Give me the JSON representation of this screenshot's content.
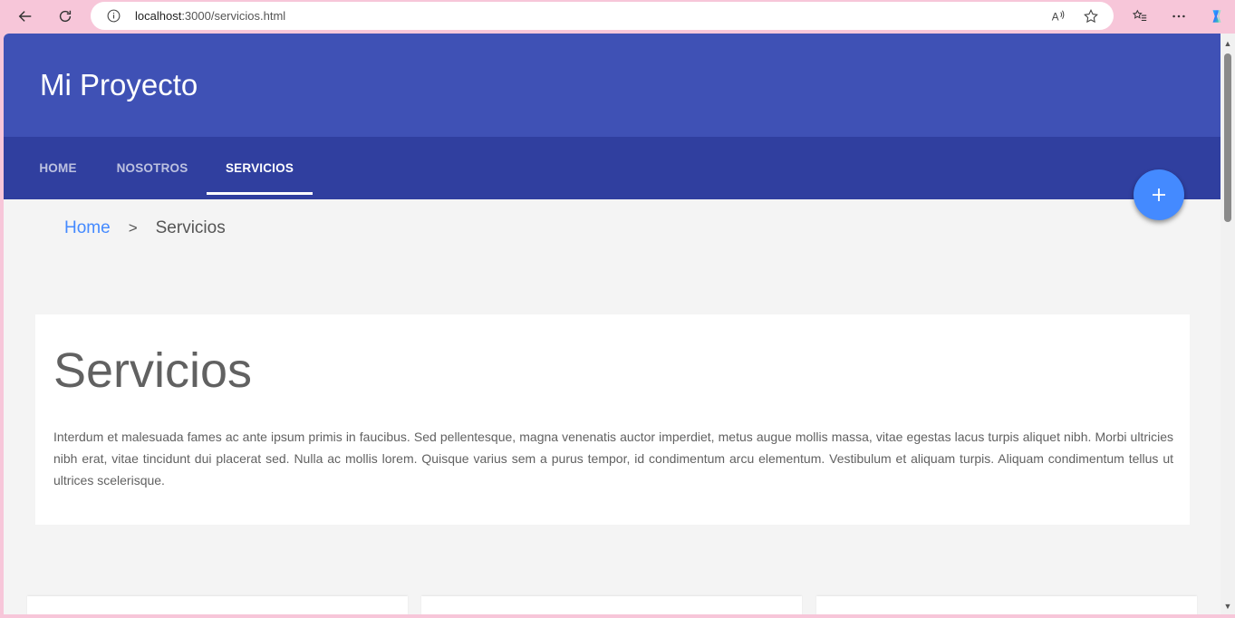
{
  "browser": {
    "url_host": "localhost",
    "url_rest": ":3000/servicios.html",
    "icons": [
      "back-icon",
      "refresh-icon",
      "info-icon",
      "read-aloud-icon",
      "favorite-star-icon",
      "favorites-list-icon",
      "more-icon",
      "copilot-icon"
    ]
  },
  "site": {
    "title": "Mi Proyecto"
  },
  "nav": {
    "tabs": [
      {
        "label": "HOME",
        "active": false
      },
      {
        "label": "NOSOTROS",
        "active": false
      },
      {
        "label": "SERVICIOS",
        "active": true
      }
    ]
  },
  "fab": {
    "label": "+"
  },
  "breadcrumb": {
    "home": "Home",
    "separator": ">",
    "current": "Servicios"
  },
  "content": {
    "heading": "Servicios",
    "paragraph": "Interdum et malesuada fames ac ante ipsum primis in faucibus. Sed pellentesque, magna venenatis auctor imperdiet, metus augue mollis massa, vitae egestas lacus turpis aliquet nibh. Morbi ultricies nibh erat, vitae tincidunt dui placerat sed. Nulla ac mollis lorem. Quisque varius sem a purus tempor, id condimentum arcu elementum. Vestibulum et aliquam turpis. Aliquam condimentum tellus ut ultrices scelerisque."
  },
  "colors": {
    "primary": "#3f51b5",
    "primary_dark": "#303f9f",
    "accent": "#448aff",
    "background": "#f4f4f4",
    "chrome": "#f7c6d9"
  }
}
